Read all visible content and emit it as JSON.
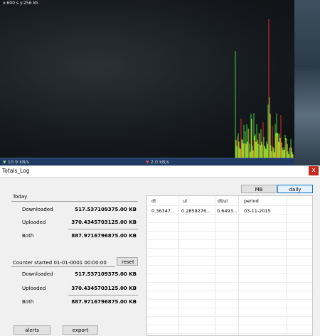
{
  "graph": {
    "scale_label": "x:600 s  y:256 kb",
    "download_rate": "10.9 kB/s",
    "upload_rate": "2.0 kB/s",
    "download_color": "#3fd23f",
    "upload_color": "#e02a2a",
    "spike_color": "#d6d61e"
  },
  "window": {
    "title": "Totals_Log",
    "close_glyph": "x"
  },
  "buttons": {
    "mb": "MB",
    "daily": "daily",
    "reset": "reset",
    "alerts": "alerts",
    "export": "export"
  },
  "today": {
    "label": "Today",
    "downloaded_label": "Downloaded",
    "downloaded_value": "517.537109375.00 KB",
    "uploaded_label": "Uploaded",
    "uploaded_value": "370.4345703125.00 KB",
    "both_label": "Both",
    "both_value": "887.9716796875.00 KB"
  },
  "counter": {
    "label": "Counter started   01-01-0001 00:00:00",
    "downloaded_label": "Downloaded",
    "downloaded_value": "517.537109375.00 KB",
    "uploaded_label": "Uploaded",
    "uploaded_value": "370.4345703125.00 KB",
    "both_label": "Both",
    "both_value": "887.9716796875.00 KB"
  },
  "log": {
    "columns": [
      "dl",
      "ul",
      "dl/ul",
      "period"
    ],
    "rows": [
      [
        "0.36347...",
        "0.2858276...",
        "0.6493...",
        "03-11-2015"
      ]
    ]
  }
}
